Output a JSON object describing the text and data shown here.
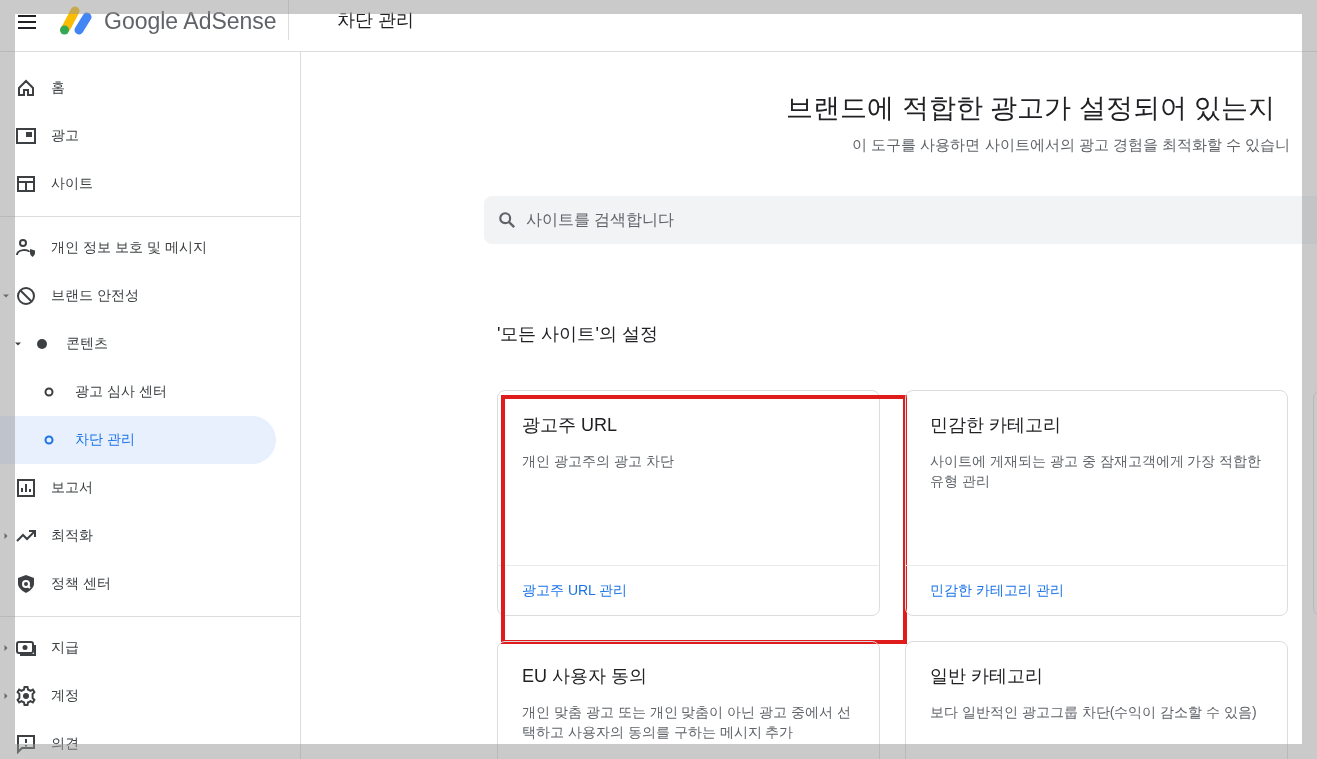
{
  "header": {
    "logo_text": "Google AdSense",
    "page_title": "차단 관리"
  },
  "sidebar": {
    "sections": [
      {
        "items": [
          {
            "label": "홈",
            "selected": false
          },
          {
            "label": "광고",
            "selected": false
          },
          {
            "label": "사이트",
            "selected": false
          }
        ]
      },
      {
        "items": [
          {
            "label": "개인 정보 보호 및 메시지",
            "selected": false
          },
          {
            "label": "브랜드 안전성",
            "selected": false,
            "expanded": true,
            "children": [
              {
                "label": "콘텐츠",
                "selected": false,
                "expanded": true,
                "children": [
                  {
                    "label": "광고 심사 센터",
                    "selected": false
                  },
                  {
                    "label": "차단 관리",
                    "selected": true
                  }
                ]
              }
            ]
          },
          {
            "label": "보고서",
            "selected": false
          },
          {
            "label": "최적화",
            "selected": false,
            "expanded": false
          },
          {
            "label": "정책 센터",
            "selected": false
          }
        ]
      },
      {
        "items": [
          {
            "label": "지급",
            "selected": false,
            "expanded": false
          },
          {
            "label": "계정",
            "selected": false,
            "expanded": false
          },
          {
            "label": "의견",
            "selected": false
          }
        ]
      }
    ]
  },
  "main": {
    "title": "브랜드에 적합한 광고가 설정되어 있는지",
    "subtitle": "이 도구를 사용하면 사이트에서의 광고 경험을 최적화할 수 있습니",
    "search": {
      "placeholder": "사이트를 검색합니다"
    },
    "section_title": "'모든 사이트'의 설정",
    "cards": [
      {
        "kind": "setting",
        "title": "광고주 URL",
        "description": "개인 광고주의 광고 차단",
        "link": "광고주 URL 관리",
        "highlighted": true
      },
      {
        "kind": "setting",
        "title": "민감한 카테고리",
        "description": "사이트에 게재되는 광고 중 잠재고객에게 가장 적합한 유형 관리",
        "link": "민감한 카테고리 관리",
        "highlighted": false
      },
      {
        "kind": "empty"
      },
      {
        "kind": "setting",
        "title": "EU 사용자 동의",
        "description": "개인 맞춤 광고 또는 개인 맞춤이 아닌 광고 중에서 선택하고 사용자의 동의를 구하는 메시지 추가",
        "highlighted": false
      },
      {
        "kind": "setting",
        "title": "일반 카테고리",
        "description": "보다 일반적인 광고그룹 차단(수익이 감소할 수 있음)",
        "highlighted": false
      }
    ]
  }
}
